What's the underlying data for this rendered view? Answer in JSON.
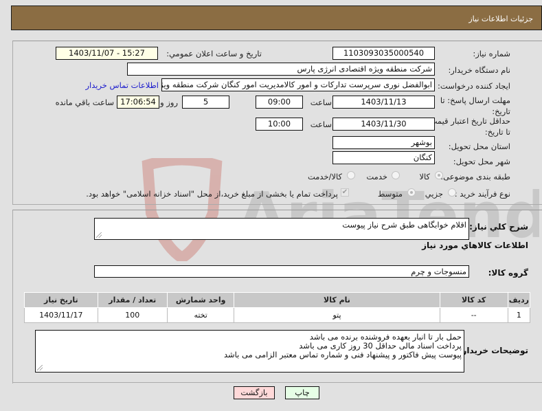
{
  "header": {
    "title": "جزئیات اطلاعات نیاز"
  },
  "details": {
    "need_number": {
      "label": "شماره نیاز:",
      "value": "1103093035000540"
    },
    "announce": {
      "label": "تاريخ و ساعت اعلان عمومي:",
      "value": "1403/11/07 - 15:27"
    },
    "buyer_org": {
      "label": "نام دستگاه خریدار:",
      "value": "شرکت منطقه ویژه اقتصادی انرژی پارس"
    },
    "requester": {
      "label": "ایجاد کننده درخواست:",
      "value": "ابوالفضل نوری سرپرست تدارکات و امور کالامدیریت امور کنگان شرکت منطقه ویژه",
      "contact_link": "اطلاعات تماس خریدار"
    },
    "reply_deadline": {
      "label": "مهلت ارسال پاسخ: تا تاریخ:",
      "date": "1403/11/13",
      "time_label": "ساعت",
      "time": "09:00",
      "days": "5",
      "days_label": "روز و",
      "remaining": "17:06:54",
      "remaining_label": "ساعت باقي مانده"
    },
    "price_validity": {
      "label": "حداقل تاریخ اعتبار قیمت: تا تاریخ:",
      "date": "1403/11/30",
      "time_label": "ساعت",
      "time": "10:00"
    },
    "province": {
      "label": "استان محل تحویل:",
      "value": "بوشهر"
    },
    "city": {
      "label": "شهر محل تحویل:",
      "value": "کنگان"
    },
    "category": {
      "label": "طبقه بندی موضوعی:",
      "options": [
        "کالا",
        "خدمت",
        "کالا/خدمت"
      ],
      "selected": "کالا"
    },
    "purchase_type": {
      "label": "نوع فرآیند خرید :",
      "options": [
        "جزیي",
        "متوسط"
      ],
      "selected": "متوسط",
      "payment_note": "پرداخت تمام یا بخشی از مبلغ خرید،از محل \"اسناد خزانه اسلامی\" خواهد بود.",
      "payment_checked": true
    }
  },
  "summary": {
    "label": "شرح کلي نياز:",
    "value": "اقلام خوابگاهی طبق شرح نیاز پیوست"
  },
  "goods_section_title": "اطلاعات کالاهاي مورد نياز",
  "goods_group": {
    "label": "گروه کالا:",
    "value": "منسوجات و چرم"
  },
  "table": {
    "headers": [
      "ردیف",
      "کد کالا",
      "نام کالا",
      "واحد شمارش",
      "تعداد / مقدار",
      "تاریخ نیاز"
    ],
    "rows": [
      [
        "1",
        "--",
        "پتو",
        "تخته",
        "100",
        "1403/11/17"
      ]
    ]
  },
  "buyer_notes": {
    "label": "توضیحات خریدار:",
    "lines": [
      "حمل بار تا انبار بعهده فروشنده برنده می باشد",
      "پرداخت اسناد مالی حداقل 30 روز کاری می باشد",
      "پیوست پیش فاکتور و پیشنهاد فنی  و شماره تماس معتبر  الزامی می باشد"
    ]
  },
  "buttons": {
    "print": "چاپ",
    "back": "بازگشت"
  },
  "watermark_text": "AriaTender.neT"
}
